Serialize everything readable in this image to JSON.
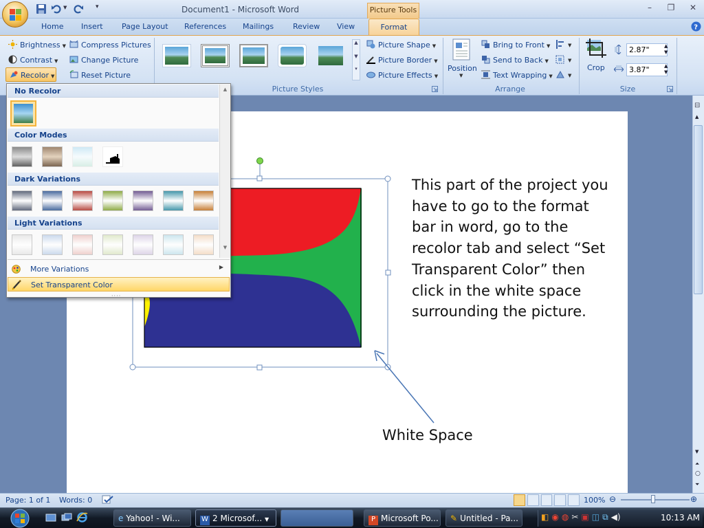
{
  "window": {
    "title": "Document1 - Microsoft Word",
    "context_tab_header": "Picture Tools"
  },
  "tabs": [
    "Home",
    "Insert",
    "Page Layout",
    "References",
    "Mailings",
    "Review",
    "View",
    "Format"
  ],
  "ribbon": {
    "adjust": {
      "brightness": "Brightness",
      "contrast": "Contrast",
      "recolor": "Recolor",
      "compress": "Compress Pictures",
      "change": "Change Picture",
      "reset": "Reset Picture"
    },
    "picture_styles": {
      "label": "Picture Styles",
      "shape": "Picture Shape",
      "border": "Picture Border",
      "effects": "Picture Effects"
    },
    "arrange": {
      "label": "Arrange",
      "position": "Position",
      "front": "Bring to Front",
      "back": "Send to Back",
      "wrap": "Text Wrapping"
    },
    "size": {
      "label": "Size",
      "crop": "Crop",
      "height": "2.87\"",
      "width": "3.87\""
    }
  },
  "recolor_menu": {
    "no_recolor": "No Recolor",
    "color_modes": "Color Modes",
    "dark_variations": "Dark Variations",
    "light_variations": "Light Variations",
    "more_variations": "More Variations",
    "set_transparent": "Set Transparent Color",
    "color_mode_swatches": [
      "grayscale",
      "sepia",
      "washout",
      "black-and-white"
    ],
    "dark_colors": [
      "#5a6377",
      "#41649a",
      "#b5423a",
      "#8aa83f",
      "#6c558f",
      "#3d93a7",
      "#c57a2e"
    ],
    "light_colors": [
      "#e8e8e8",
      "#c9d8ec",
      "#efcfcc",
      "#e0e9cb",
      "#dcd3e7",
      "#cbe6ee",
      "#f4dcc6"
    ]
  },
  "document": {
    "body": "This part of the project you have to go to the format bar in word, go to the recolor tab and select “Set Transparent Color” then click in the white space surrounding the picture.",
    "annotation": "White Space",
    "picture_colors": {
      "red": "#ed1c24",
      "green": "#22b14c",
      "blue": "#2e3192",
      "yellow": "#fff200"
    }
  },
  "status": {
    "page": "Page: 1 of 1",
    "words": "Words: 0",
    "zoom": "100%"
  },
  "taskbar": {
    "items": [
      "Yahoo! - Wi...",
      "2 Microsof...",
      "",
      "Microsoft Po...",
      "Untitled - Pa..."
    ],
    "time": "10:13 AM"
  }
}
